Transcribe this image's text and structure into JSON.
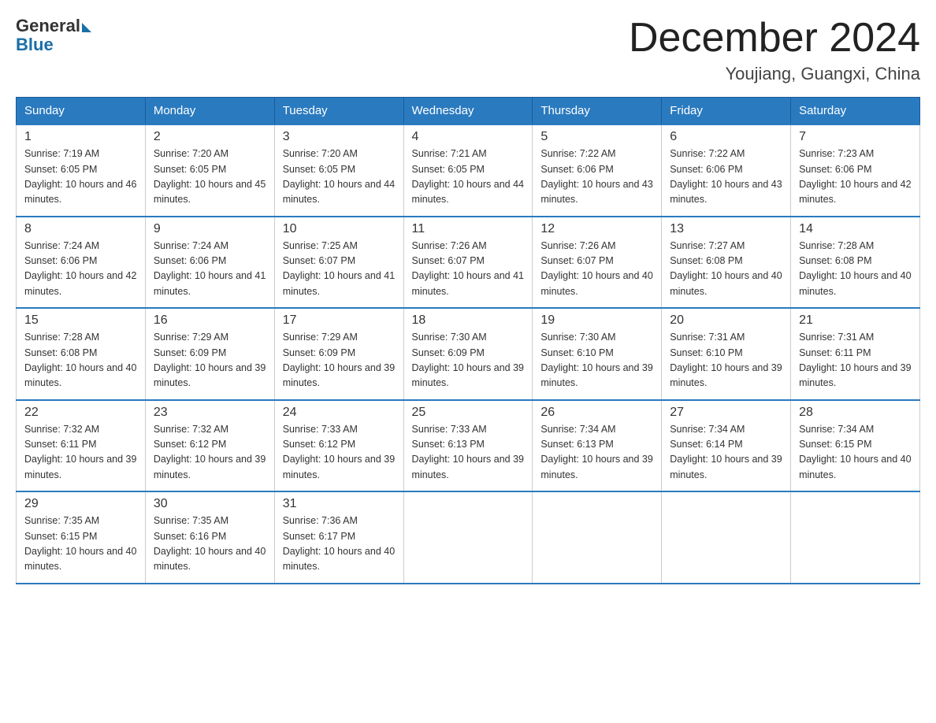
{
  "logo": {
    "general": "General",
    "blue": "Blue"
  },
  "title": "December 2024",
  "location": "Youjiang, Guangxi, China",
  "headers": [
    "Sunday",
    "Monday",
    "Tuesday",
    "Wednesday",
    "Thursday",
    "Friday",
    "Saturday"
  ],
  "weeks": [
    [
      {
        "day": "1",
        "sunrise": "7:19 AM",
        "sunset": "6:05 PM",
        "daylight": "10 hours and 46 minutes."
      },
      {
        "day": "2",
        "sunrise": "7:20 AM",
        "sunset": "6:05 PM",
        "daylight": "10 hours and 45 minutes."
      },
      {
        "day": "3",
        "sunrise": "7:20 AM",
        "sunset": "6:05 PM",
        "daylight": "10 hours and 44 minutes."
      },
      {
        "day": "4",
        "sunrise": "7:21 AM",
        "sunset": "6:05 PM",
        "daylight": "10 hours and 44 minutes."
      },
      {
        "day": "5",
        "sunrise": "7:22 AM",
        "sunset": "6:06 PM",
        "daylight": "10 hours and 43 minutes."
      },
      {
        "day": "6",
        "sunrise": "7:22 AM",
        "sunset": "6:06 PM",
        "daylight": "10 hours and 43 minutes."
      },
      {
        "day": "7",
        "sunrise": "7:23 AM",
        "sunset": "6:06 PM",
        "daylight": "10 hours and 42 minutes."
      }
    ],
    [
      {
        "day": "8",
        "sunrise": "7:24 AM",
        "sunset": "6:06 PM",
        "daylight": "10 hours and 42 minutes."
      },
      {
        "day": "9",
        "sunrise": "7:24 AM",
        "sunset": "6:06 PM",
        "daylight": "10 hours and 41 minutes."
      },
      {
        "day": "10",
        "sunrise": "7:25 AM",
        "sunset": "6:07 PM",
        "daylight": "10 hours and 41 minutes."
      },
      {
        "day": "11",
        "sunrise": "7:26 AM",
        "sunset": "6:07 PM",
        "daylight": "10 hours and 41 minutes."
      },
      {
        "day": "12",
        "sunrise": "7:26 AM",
        "sunset": "6:07 PM",
        "daylight": "10 hours and 40 minutes."
      },
      {
        "day": "13",
        "sunrise": "7:27 AM",
        "sunset": "6:08 PM",
        "daylight": "10 hours and 40 minutes."
      },
      {
        "day": "14",
        "sunrise": "7:28 AM",
        "sunset": "6:08 PM",
        "daylight": "10 hours and 40 minutes."
      }
    ],
    [
      {
        "day": "15",
        "sunrise": "7:28 AM",
        "sunset": "6:08 PM",
        "daylight": "10 hours and 40 minutes."
      },
      {
        "day": "16",
        "sunrise": "7:29 AM",
        "sunset": "6:09 PM",
        "daylight": "10 hours and 39 minutes."
      },
      {
        "day": "17",
        "sunrise": "7:29 AM",
        "sunset": "6:09 PM",
        "daylight": "10 hours and 39 minutes."
      },
      {
        "day": "18",
        "sunrise": "7:30 AM",
        "sunset": "6:09 PM",
        "daylight": "10 hours and 39 minutes."
      },
      {
        "day": "19",
        "sunrise": "7:30 AM",
        "sunset": "6:10 PM",
        "daylight": "10 hours and 39 minutes."
      },
      {
        "day": "20",
        "sunrise": "7:31 AM",
        "sunset": "6:10 PM",
        "daylight": "10 hours and 39 minutes."
      },
      {
        "day": "21",
        "sunrise": "7:31 AM",
        "sunset": "6:11 PM",
        "daylight": "10 hours and 39 minutes."
      }
    ],
    [
      {
        "day": "22",
        "sunrise": "7:32 AM",
        "sunset": "6:11 PM",
        "daylight": "10 hours and 39 minutes."
      },
      {
        "day": "23",
        "sunrise": "7:32 AM",
        "sunset": "6:12 PM",
        "daylight": "10 hours and 39 minutes."
      },
      {
        "day": "24",
        "sunrise": "7:33 AM",
        "sunset": "6:12 PM",
        "daylight": "10 hours and 39 minutes."
      },
      {
        "day": "25",
        "sunrise": "7:33 AM",
        "sunset": "6:13 PM",
        "daylight": "10 hours and 39 minutes."
      },
      {
        "day": "26",
        "sunrise": "7:34 AM",
        "sunset": "6:13 PM",
        "daylight": "10 hours and 39 minutes."
      },
      {
        "day": "27",
        "sunrise": "7:34 AM",
        "sunset": "6:14 PM",
        "daylight": "10 hours and 39 minutes."
      },
      {
        "day": "28",
        "sunrise": "7:34 AM",
        "sunset": "6:15 PM",
        "daylight": "10 hours and 40 minutes."
      }
    ],
    [
      {
        "day": "29",
        "sunrise": "7:35 AM",
        "sunset": "6:15 PM",
        "daylight": "10 hours and 40 minutes."
      },
      {
        "day": "30",
        "sunrise": "7:35 AM",
        "sunset": "6:16 PM",
        "daylight": "10 hours and 40 minutes."
      },
      {
        "day": "31",
        "sunrise": "7:36 AM",
        "sunset": "6:17 PM",
        "daylight": "10 hours and 40 minutes."
      },
      null,
      null,
      null,
      null
    ]
  ]
}
